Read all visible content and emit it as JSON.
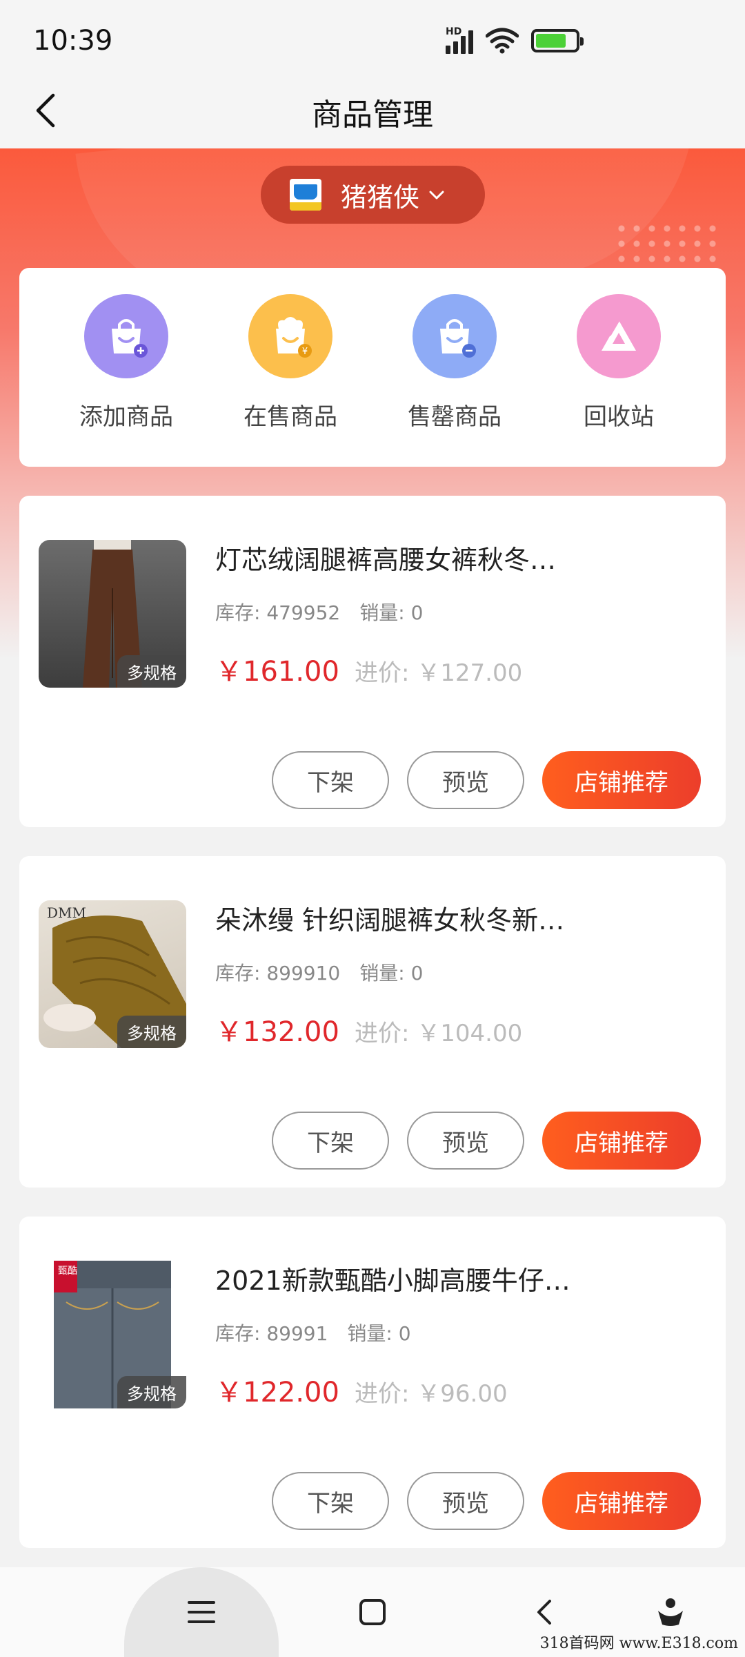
{
  "status_bar": {
    "time": "10:39",
    "hd_label": "HD",
    "icons": [
      "signal-icon",
      "wifi-icon",
      "battery-charging-icon"
    ]
  },
  "header": {
    "title": "商品管理",
    "back_icon": "chevron-left-icon"
  },
  "shop": {
    "name": "猪猪侠",
    "logo_icon": "shop-cart-logo",
    "dropdown_icon": "chevron-down-icon"
  },
  "quick_actions": [
    {
      "label": "添加商品",
      "icon": "shopping-bag-plus-icon",
      "color": "#9f8cf0"
    },
    {
      "label": "在售商品",
      "icon": "shopping-bag-yen-icon",
      "color": "#fbbe49"
    },
    {
      "label": "售罄商品",
      "icon": "shopping-bag-minus-icon",
      "color": "#8aa8f5"
    },
    {
      "label": "回收站",
      "icon": "recycle-triangle-icon",
      "color": "#f497cf"
    }
  ],
  "products": [
    {
      "title": "灯芯绒阔腿裤高腰女裤秋冬…",
      "stock_label": "库存:",
      "stock": "479952",
      "sales_label": "销量:",
      "sales": "0",
      "price": "￥161.00",
      "cost_label": "进价:",
      "cost": "￥127.00",
      "spec_tag": "多规格",
      "buttons": {
        "off": "下架",
        "preview": "预览",
        "recommend": "店铺推荐"
      }
    },
    {
      "title": "朵沐缦 针织阔腿裤女秋冬新…",
      "stock_label": "库存:",
      "stock": "899910",
      "sales_label": "销量:",
      "sales": "0",
      "price": "￥132.00",
      "cost_label": "进价:",
      "cost": "￥104.00",
      "spec_tag": "多规格",
      "brand_text": "DMM",
      "buttons": {
        "off": "下架",
        "preview": "预览",
        "recommend": "店铺推荐"
      }
    },
    {
      "title": "2021新款甄酷小脚高腰牛仔…",
      "stock_label": "库存:",
      "stock": "89991",
      "sales_label": "销量:",
      "sales": "0",
      "price": "￥122.00",
      "cost_label": "进价:",
      "cost": "￥96.00",
      "spec_tag": "多规格",
      "brand_text": "甄酷",
      "buttons": {
        "off": "下架",
        "preview": "预览",
        "recommend": "店铺推荐"
      }
    }
  ],
  "nav_bar": {
    "icons": [
      "menu-icon",
      "home-square-icon",
      "back-chevron-icon",
      "assistant-icon"
    ]
  },
  "watermark": "318首码网 www.E318.com"
}
